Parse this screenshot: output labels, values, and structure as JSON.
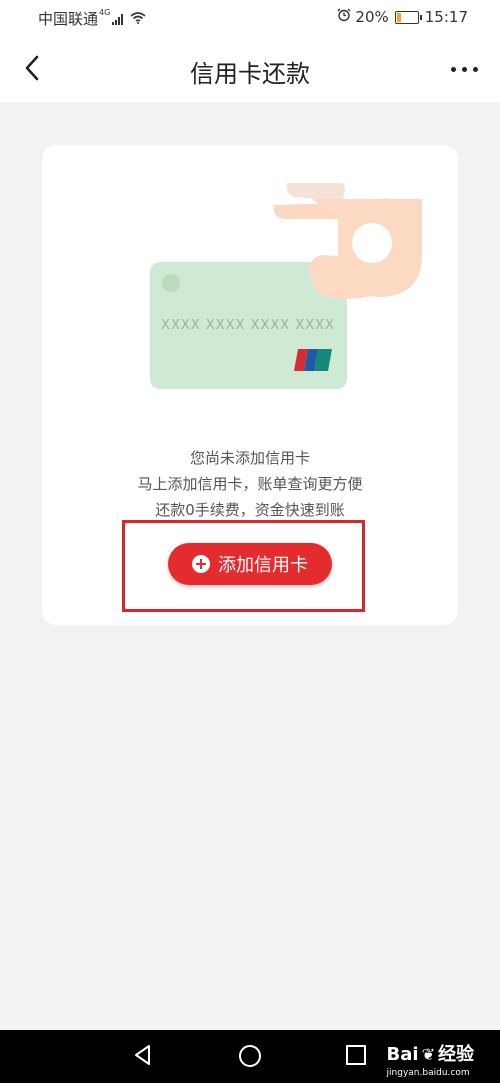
{
  "status_bar": {
    "carrier": "中国联通",
    "network": "4G",
    "battery_percent": "20%",
    "battery_level": 0.2,
    "time": "15:17"
  },
  "header": {
    "title": "信用卡还款"
  },
  "card_illustration": {
    "card_number_mask": "XXXX XXXX XXXX XXXX",
    "card_color": "#cfe9d4",
    "hand_color": "#fbdcc6"
  },
  "empty_state": {
    "line1": "您尚未添加信用卡",
    "line2": "马上添加信用卡，账单查询更方便",
    "line3": "还款0手续费，资金快速到账",
    "add_button_label": "添加信用卡"
  },
  "colors": {
    "accent": "#e42b2e",
    "highlight": "#d9252b"
  },
  "watermark": {
    "brand": "Bai",
    "brand_suffix": "经验",
    "domain": "jingyan.baidu.com"
  }
}
